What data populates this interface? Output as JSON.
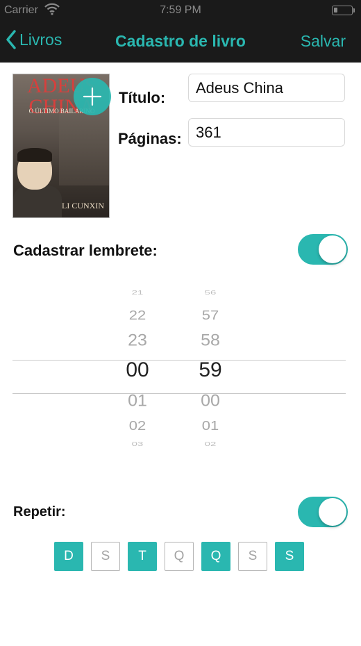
{
  "status_bar": {
    "carrier": "Carrier",
    "time": "7:59 PM"
  },
  "nav": {
    "back_label": "Livros",
    "title": "Cadastro de livro",
    "save_label": "Salvar"
  },
  "colors": {
    "accent": "#2ab7b0",
    "nav_background": "#1a1a1a",
    "content_background": "#ffffff"
  },
  "book": {
    "cover": {
      "title": "ADEUS CHINA",
      "subtitle": "O ÚLTIMO BAILARINO",
      "author": "LI CUNXIN"
    },
    "fields": {
      "title_label": "Título:",
      "title_value": "Adeus China",
      "pages_label": "Páginas:",
      "pages_value": "361"
    }
  },
  "reminder": {
    "label": "Cadastrar lembrete:",
    "enabled": true,
    "picker": {
      "hours": [
        "21",
        "22",
        "23",
        "00",
        "01",
        "02",
        "03"
      ],
      "minutes": [
        "56",
        "57",
        "58",
        "59",
        "00",
        "01",
        "02"
      ],
      "selected_hour": "00",
      "selected_minute": "59"
    }
  },
  "repeat": {
    "label": "Repetir:",
    "enabled": true,
    "days": [
      {
        "label": "D",
        "selected": true
      },
      {
        "label": "S",
        "selected": false
      },
      {
        "label": "T",
        "selected": true
      },
      {
        "label": "Q",
        "selected": false
      },
      {
        "label": "Q",
        "selected": true
      },
      {
        "label": "S",
        "selected": false
      },
      {
        "label": "S",
        "selected": true
      }
    ]
  }
}
